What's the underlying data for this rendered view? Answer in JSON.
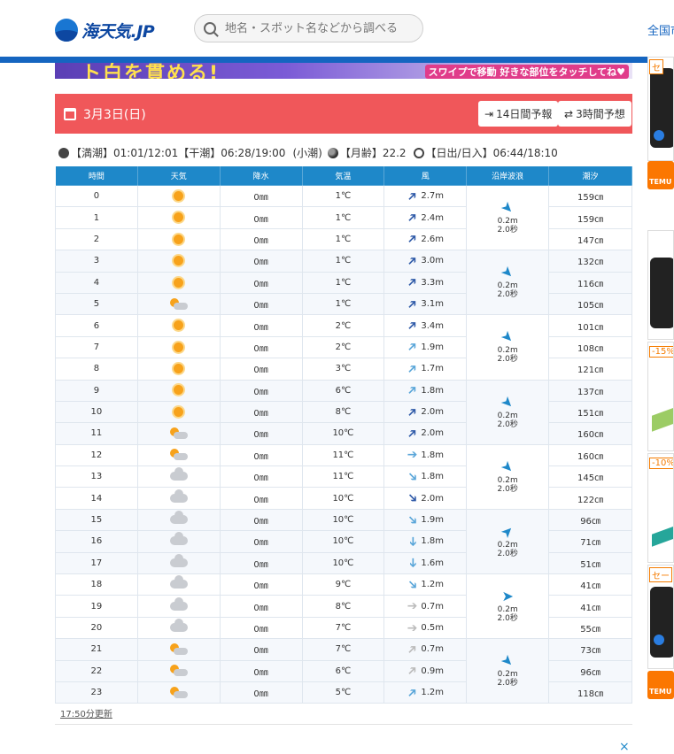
{
  "header": {
    "logo_text": "海天気.JP",
    "search_placeholder": "地名・スポット名などから調べる",
    "nav_link": "全国市"
  },
  "banner": {
    "headline": "ト白を貫める!",
    "sub": "スワイプで移動 好きな部位をタッチしてね♥"
  },
  "day": {
    "title": "3月3日(日)",
    "btn_14day": "14日間予報",
    "btn_3hour": "3時間予想"
  },
  "tide_info": {
    "high": "【満潮】01:01/12:01",
    "low": "【干潮】06:28/19:00",
    "tide_type": "(小潮)",
    "moon_age": "【月齢】22.2",
    "sun": "【日出/日入】06:44/18:10"
  },
  "table": {
    "headers": [
      "時間",
      "天気",
      "降水",
      "気温",
      "風",
      "沿岸波浪",
      "潮汐"
    ],
    "rows": [
      {
        "hour": "0",
        "weather": "sun",
        "precip": "0㎜",
        "temp": "1℃",
        "wind_dir": "ne",
        "wind_color": "#2f5aa8",
        "wind": "2.7m",
        "tide": "159㎝"
      },
      {
        "hour": "1",
        "weather": "sun",
        "precip": "0㎜",
        "temp": "1℃",
        "wind_dir": "ne",
        "wind_color": "#2f5aa8",
        "wind": "2.4m",
        "tide": "159㎝"
      },
      {
        "hour": "2",
        "weather": "sun",
        "precip": "0㎜",
        "temp": "1℃",
        "wind_dir": "ne",
        "wind_color": "#2f5aa8",
        "wind": "2.6m",
        "tide": "147㎝"
      },
      {
        "hour": "3",
        "weather": "sun",
        "precip": "0㎜",
        "temp": "1℃",
        "wind_dir": "ne",
        "wind_color": "#2f5aa8",
        "wind": "3.0m",
        "tide": "132㎝"
      },
      {
        "hour": "4",
        "weather": "sun",
        "precip": "0㎜",
        "temp": "1℃",
        "wind_dir": "ne",
        "wind_color": "#2f5aa8",
        "wind": "3.3m",
        "tide": "116㎝"
      },
      {
        "hour": "5",
        "weather": "sun-cloud",
        "precip": "0㎜",
        "temp": "1℃",
        "wind_dir": "ne",
        "wind_color": "#2f5aa8",
        "wind": "3.1m",
        "tide": "105㎝"
      },
      {
        "hour": "6",
        "weather": "sun",
        "precip": "0㎜",
        "temp": "2℃",
        "wind_dir": "ne",
        "wind_color": "#2f5aa8",
        "wind": "3.4m",
        "tide": "101㎝"
      },
      {
        "hour": "7",
        "weather": "sun",
        "precip": "0㎜",
        "temp": "2℃",
        "wind_dir": "ne",
        "wind_color": "#5aa6d9",
        "wind": "1.9m",
        "tide": "108㎝"
      },
      {
        "hour": "8",
        "weather": "sun",
        "precip": "0㎜",
        "temp": "3℃",
        "wind_dir": "ne",
        "wind_color": "#5aa6d9",
        "wind": "1.7m",
        "tide": "121㎝"
      },
      {
        "hour": "9",
        "weather": "sun",
        "precip": "0㎜",
        "temp": "6℃",
        "wind_dir": "ne",
        "wind_color": "#5aa6d9",
        "wind": "1.8m",
        "tide": "137㎝"
      },
      {
        "hour": "10",
        "weather": "sun",
        "precip": "0㎜",
        "temp": "8℃",
        "wind_dir": "ne",
        "wind_color": "#2f5aa8",
        "wind": "2.0m",
        "tide": "151㎝"
      },
      {
        "hour": "11",
        "weather": "sun-cloud",
        "precip": "0㎜",
        "temp": "10℃",
        "wind_dir": "ne",
        "wind_color": "#2f5aa8",
        "wind": "2.0m",
        "tide": "160㎝"
      },
      {
        "hour": "12",
        "weather": "sun-cloud",
        "precip": "0㎜",
        "temp": "11℃",
        "wind_dir": "e",
        "wind_color": "#5aa6d9",
        "wind": "1.8m",
        "tide": "160㎝"
      },
      {
        "hour": "13",
        "weather": "cloud",
        "precip": "0㎜",
        "temp": "11℃",
        "wind_dir": "se",
        "wind_color": "#5aa6d9",
        "wind": "1.8m",
        "tide": "145㎝"
      },
      {
        "hour": "14",
        "weather": "cloud",
        "precip": "0㎜",
        "temp": "10℃",
        "wind_dir": "se",
        "wind_color": "#2f5aa8",
        "wind": "2.0m",
        "tide": "122㎝"
      },
      {
        "hour": "15",
        "weather": "cloud",
        "precip": "0㎜",
        "temp": "10℃",
        "wind_dir": "se",
        "wind_color": "#5aa6d9",
        "wind": "1.9m",
        "tide": "96㎝"
      },
      {
        "hour": "16",
        "weather": "cloud",
        "precip": "0㎜",
        "temp": "10℃",
        "wind_dir": "s",
        "wind_color": "#5aa6d9",
        "wind": "1.8m",
        "tide": "71㎝"
      },
      {
        "hour": "17",
        "weather": "cloud",
        "precip": "0㎜",
        "temp": "10℃",
        "wind_dir": "s",
        "wind_color": "#5aa6d9",
        "wind": "1.6m",
        "tide": "51㎝"
      },
      {
        "hour": "18",
        "weather": "cloud",
        "precip": "0㎜",
        "temp": "9℃",
        "wind_dir": "se",
        "wind_color": "#5aa6d9",
        "wind": "1.2m",
        "tide": "41㎝"
      },
      {
        "hour": "19",
        "weather": "cloud",
        "precip": "0㎜",
        "temp": "8℃",
        "wind_dir": "e",
        "wind_color": "#bbbbbb",
        "wind": "0.7m",
        "tide": "41㎝"
      },
      {
        "hour": "20",
        "weather": "cloud",
        "precip": "0㎜",
        "temp": "7℃",
        "wind_dir": "e",
        "wind_color": "#bbbbbb",
        "wind": "0.5m",
        "tide": "55㎝"
      },
      {
        "hour": "21",
        "weather": "sun-cloud",
        "precip": "0㎜",
        "temp": "7℃",
        "wind_dir": "ne",
        "wind_color": "#bbbbbb",
        "wind": "0.7m",
        "tide": "73㎝"
      },
      {
        "hour": "22",
        "weather": "sun-cloud",
        "precip": "0㎜",
        "temp": "6℃",
        "wind_dir": "ne",
        "wind_color": "#bbbbbb",
        "wind": "0.9m",
        "tide": "96㎝"
      },
      {
        "hour": "23",
        "weather": "sun-cloud",
        "precip": "0㎜",
        "temp": "5℃",
        "wind_dir": "ne",
        "wind_color": "#5aa6d9",
        "wind": "1.2m",
        "tide": "118㎝"
      }
    ],
    "waves": [
      {
        "dir": "nw",
        "height": "0.2m",
        "period": "2.0秒"
      },
      {
        "dir": "nw",
        "height": "0.2m",
        "period": "2.0秒"
      },
      {
        "dir": "nw",
        "height": "0.2m",
        "period": "2.0秒"
      },
      {
        "dir": "nw",
        "height": "0.2m",
        "period": "2.0秒"
      },
      {
        "dir": "nw",
        "height": "0.2m",
        "period": "2.0秒"
      },
      {
        "dir": "sw",
        "height": "0.2m",
        "period": "2.0秒"
      },
      {
        "dir": "w",
        "height": "0.2m",
        "period": "2.0秒"
      },
      {
        "dir": "nw",
        "height": "0.2m",
        "period": "2.0秒"
      }
    ]
  },
  "footer": {
    "updated": "17:50分更新",
    "close": "×"
  },
  "ads": {
    "tags": [
      "セ",
      "-15%",
      "-10%",
      "セー"
    ],
    "temu": "TEMU"
  }
}
